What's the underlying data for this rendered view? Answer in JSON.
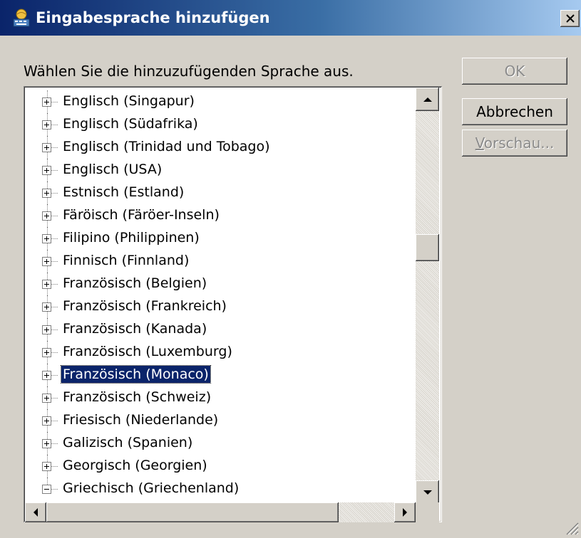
{
  "window": {
    "title": "Eingabesprache hinzufügen"
  },
  "instruction": "Wählen Sie die hinzuzufügenden Sprache aus.",
  "buttons": {
    "ok": "OK",
    "cancel": "Abbrechen",
    "preview_mnemonic": "V",
    "preview_rest": "orschau..."
  },
  "languages": [
    {
      "label": "Englisch (Singapur)",
      "state": "collapsed"
    },
    {
      "label": "Englisch (Südafrika)",
      "state": "collapsed"
    },
    {
      "label": "Englisch (Trinidad und Tobago)",
      "state": "collapsed"
    },
    {
      "label": "Englisch (USA)",
      "state": "collapsed"
    },
    {
      "label": "Estnisch (Estland)",
      "state": "collapsed"
    },
    {
      "label": "Färöisch (Färöer-Inseln)",
      "state": "collapsed"
    },
    {
      "label": "Filipino (Philippinen)",
      "state": "collapsed"
    },
    {
      "label": "Finnisch (Finnland)",
      "state": "collapsed"
    },
    {
      "label": "Französisch (Belgien)",
      "state": "collapsed"
    },
    {
      "label": "Französisch (Frankreich)",
      "state": "collapsed"
    },
    {
      "label": "Französisch (Kanada)",
      "state": "collapsed"
    },
    {
      "label": "Französisch (Luxemburg)",
      "state": "collapsed"
    },
    {
      "label": "Französisch (Monaco)",
      "state": "collapsed",
      "selected": true
    },
    {
      "label": "Französisch (Schweiz)",
      "state": "collapsed"
    },
    {
      "label": "Friesisch (Niederlande)",
      "state": "collapsed"
    },
    {
      "label": "Galizisch (Spanien)",
      "state": "collapsed"
    },
    {
      "label": "Georgisch (Georgien)",
      "state": "collapsed"
    },
    {
      "label": "Griechisch (Griechenland)",
      "state": "expanded"
    }
  ],
  "scroll": {
    "vertical_position": 0.36
  },
  "colors": {
    "selection": "#0a246a",
    "titlebar_start": "#0a246a",
    "titlebar_end": "#a6caf0"
  }
}
